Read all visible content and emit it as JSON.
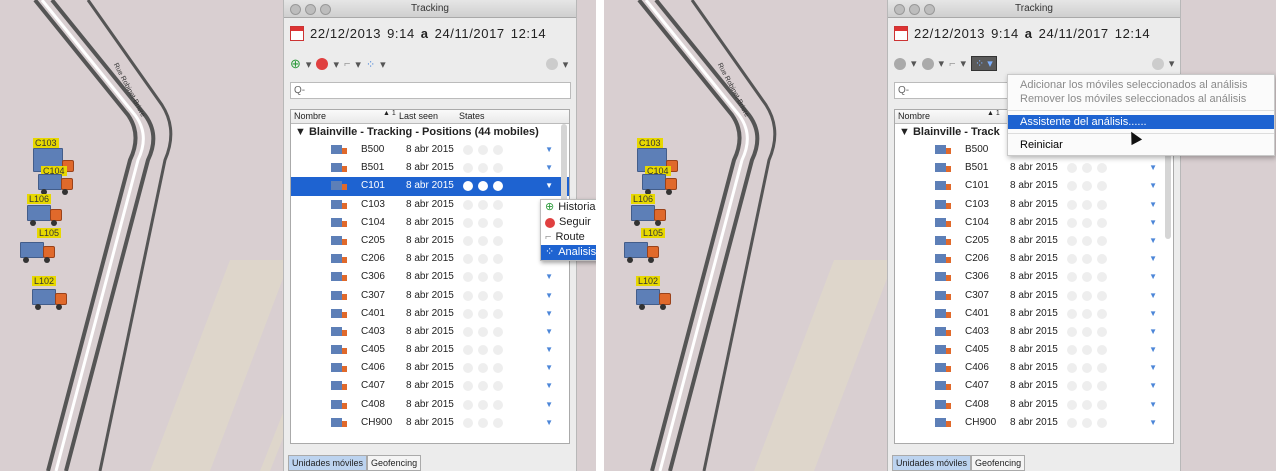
{
  "street_name": "Rue Robinet-Briere",
  "window_title": "Tracking",
  "date_range": {
    "from_date": "22/12/2013",
    "from_time": "9:14",
    "separator": "a",
    "to_date": "24/11/2017",
    "to_time": "12:14"
  },
  "search": {
    "placeholder": "Q-"
  },
  "columns": {
    "name": "Nombre",
    "sort_indicator": "▲ 1",
    "last_seen": "Last seen",
    "states": "States"
  },
  "group_label": "Blainville - Tracking - Positions (44 mobiles)",
  "group_label_short": "Blainville - Track",
  "rows": [
    {
      "name": "B500",
      "date": "8 abr 2015"
    },
    {
      "name": "B501",
      "date": "8 abr 2015"
    },
    {
      "name": "C101",
      "date": "8 abr 2015"
    },
    {
      "name": "C103",
      "date": "8 abr 2015"
    },
    {
      "name": "C104",
      "date": "8 abr 2015"
    },
    {
      "name": "C205",
      "date": "8 abr 2015"
    },
    {
      "name": "C206",
      "date": "8 abr 2015"
    },
    {
      "name": "C306",
      "date": "8 abr 2015"
    },
    {
      "name": "C307",
      "date": "8 abr 2015"
    },
    {
      "name": "C401",
      "date": "8 abr 2015"
    },
    {
      "name": "C403",
      "date": "8 abr 2015"
    },
    {
      "name": "C405",
      "date": "8 abr 2015"
    },
    {
      "name": "C406",
      "date": "8 abr 2015"
    },
    {
      "name": "C407",
      "date": "8 abr 2015"
    },
    {
      "name": "C408",
      "date": "8 abr 2015"
    },
    {
      "name": "CH900",
      "date": "8 abr 2015"
    }
  ],
  "map_vehicles": [
    "C103",
    "C104",
    "L106",
    "L105",
    "L102"
  ],
  "context_menu": {
    "items": [
      "Historial",
      "Seguir",
      "Route",
      "Analisis"
    ]
  },
  "analysis_menu": {
    "items": [
      "Adicionar los móviles seleccionados al análisis",
      "Remover los móviles seleccionados al análisis",
      "Assistente del análisis......",
      "Reiniciar"
    ]
  },
  "tabs": [
    "Unidades móviles",
    "Geofencing"
  ],
  "colors": {
    "selection": "#1e63d1",
    "map_bg": "#d9cfd1",
    "label_yellow": "#e7d800",
    "accent": "#4c86d8"
  }
}
